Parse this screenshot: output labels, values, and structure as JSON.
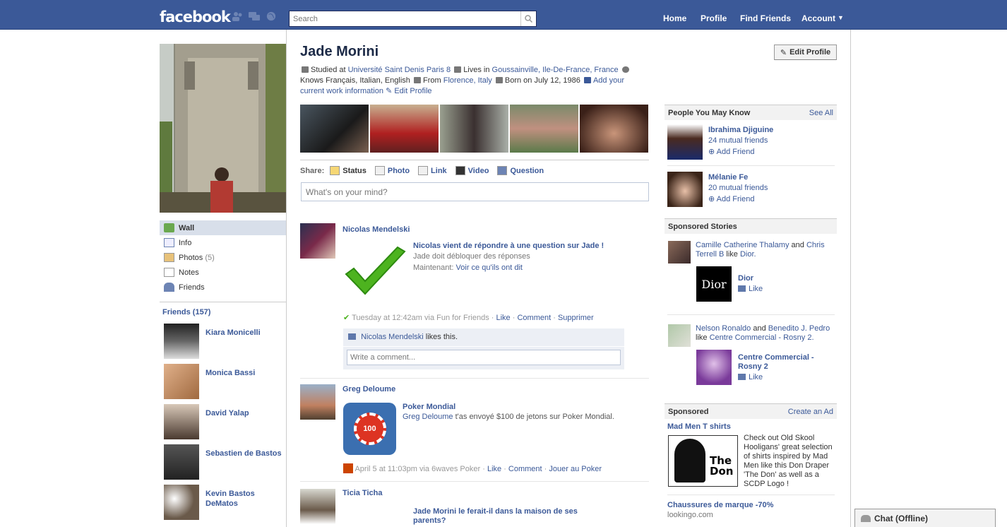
{
  "topbar": {
    "logo": "facebook",
    "search_placeholder": "Search",
    "nav": [
      "Home",
      "Profile",
      "Find Friends",
      "Account"
    ]
  },
  "profile": {
    "name": "Jade Morini",
    "edit_button": "Edit Profile",
    "info": {
      "studied_prefix": "Studied at",
      "school": "Université Saint Denis Paris 8",
      "lives_prefix": "Lives in",
      "lives": "Goussainville, Ile-De-France, France",
      "knows": "Knows Français, Italian, English",
      "from_prefix": "From",
      "from": "Florence, Italy",
      "born": "Born on July 12, 1986",
      "add_work": "Add your current work information",
      "edit_profile": "Edit Profile"
    }
  },
  "sidebar": {
    "nav": [
      {
        "label": "Wall",
        "count": ""
      },
      {
        "label": "Info",
        "count": ""
      },
      {
        "label": "Photos",
        "count": "(5)"
      },
      {
        "label": "Notes",
        "count": ""
      },
      {
        "label": "Friends",
        "count": ""
      }
    ],
    "friends_header": "Friends (157)",
    "friends": [
      "Kiara Monicelli",
      "Monica Bassi",
      "David Yalap",
      "Sebastien de Bastos",
      "Kevin Bastos DeMatos"
    ]
  },
  "share": {
    "label": "Share:",
    "options": [
      "Status",
      "Photo",
      "Link",
      "Video",
      "Question"
    ],
    "placeholder": "What's on your mind?"
  },
  "feed": [
    {
      "actor": "Nicolas Mendelski",
      "title": "Nicolas vient de répondre à une question sur Jade !",
      "line1": "Jade doit débloquer des réponses",
      "line2_prefix": "Maintenant:",
      "line2_link": "Voir ce qu'ils ont dit",
      "time": "Tuesday at 12:42am via Fun for Friends",
      "actions": [
        "Like",
        "Comment",
        "Supprimer"
      ],
      "likes_name": "Nicolas Mendelski",
      "likes_suffix": "likes this.",
      "comment_placeholder": "Write a comment..."
    },
    {
      "actor": "Greg Deloume",
      "title": "Poker Mondial",
      "body_link": "Greg Deloume",
      "body": "t'as envoyé $100 de jetons sur Poker Mondial.",
      "chip": "100",
      "time": "April 5 at 11:03pm via 6waves Poker",
      "actions": [
        "Like",
        "Comment",
        "Jouer au Poker"
      ]
    },
    {
      "actor": "Ticia Ticha",
      "title": "Jade Morini le ferait-il dans la maison de ses parents?"
    }
  ],
  "right": {
    "pymk_header": "People You May Know",
    "see_all": "See All",
    "pymk": [
      {
        "name": "Ibrahima Djiguine",
        "mutual": "24 mutual friends",
        "add": "Add Friend"
      },
      {
        "name": "Mélanie Fe",
        "mutual": "20 mutual friends",
        "add": "Add Friend"
      }
    ],
    "sponsored_stories_header": "Sponsored Stories",
    "stories": [
      {
        "people1": "Camille Catherine Thalamy",
        "and": "and",
        "people2": "Chris Terrell B",
        "like": "like",
        "page": "Dior.",
        "page_name": "Dior",
        "like_btn": "Like",
        "logo": "Dior"
      },
      {
        "people1": "Nelson Ronaldo",
        "and": "and",
        "people2": "Benedito J. Pedro",
        "like": "like",
        "page": "Centre Commercial - Rosny 2.",
        "page_name": "Centre Commercial - Rosny 2",
        "like_btn": "Like"
      }
    ],
    "sponsored_header": "Sponsored",
    "create_ad": "Create an Ad",
    "ads": [
      {
        "title": "Mad Men T shirts",
        "text": "Check out Old Skool Hooligans' great selection of shirts inspired by Mad Men like this Don Draper 'The Don' as well as a SCDP Logo !",
        "img_text": "The Don"
      },
      {
        "title": "Chaussures de marque -70%",
        "domain": "lookingo.com"
      }
    ]
  },
  "chat": "Chat (Offline)",
  "colors": {
    "brand": "#3b5998",
    "link": "#3b5998",
    "nav_selected": "#d8dfea"
  }
}
